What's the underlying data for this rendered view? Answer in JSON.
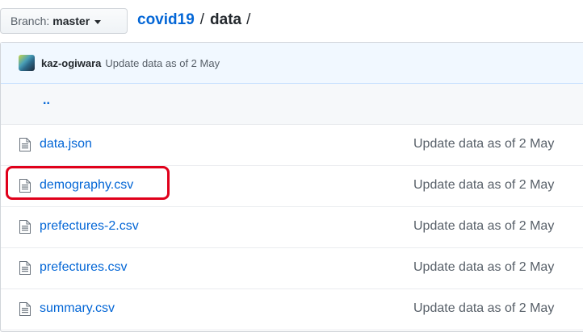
{
  "branch": {
    "label": "Branch:",
    "value": "master"
  },
  "breadcrumb": {
    "repo": "covid19",
    "separator": "/",
    "current": "data",
    "trailing": "/"
  },
  "latest_commit": {
    "author": "kaz-ogiwara",
    "message": "Update data as of 2 May"
  },
  "up_link": "..",
  "files": [
    {
      "name": "data.json",
      "commit": "Update data as of 2 May",
      "icon": "file-icon"
    },
    {
      "name": "demography.csv",
      "commit": "Update data as of 2 May",
      "icon": "file-icon",
      "highlighted": true
    },
    {
      "name": "prefectures-2.csv",
      "commit": "Update data as of 2 May",
      "icon": "file-icon"
    },
    {
      "name": "prefectures.csv",
      "commit": "Update data as of 2 May",
      "icon": "file-icon"
    },
    {
      "name": "summary.csv",
      "commit": "Update data as of 2 May",
      "icon": "file-icon"
    }
  ],
  "colors": {
    "link": "#0366d6",
    "highlight": "#e0001b",
    "commit_bar": "#f1f8ff"
  }
}
